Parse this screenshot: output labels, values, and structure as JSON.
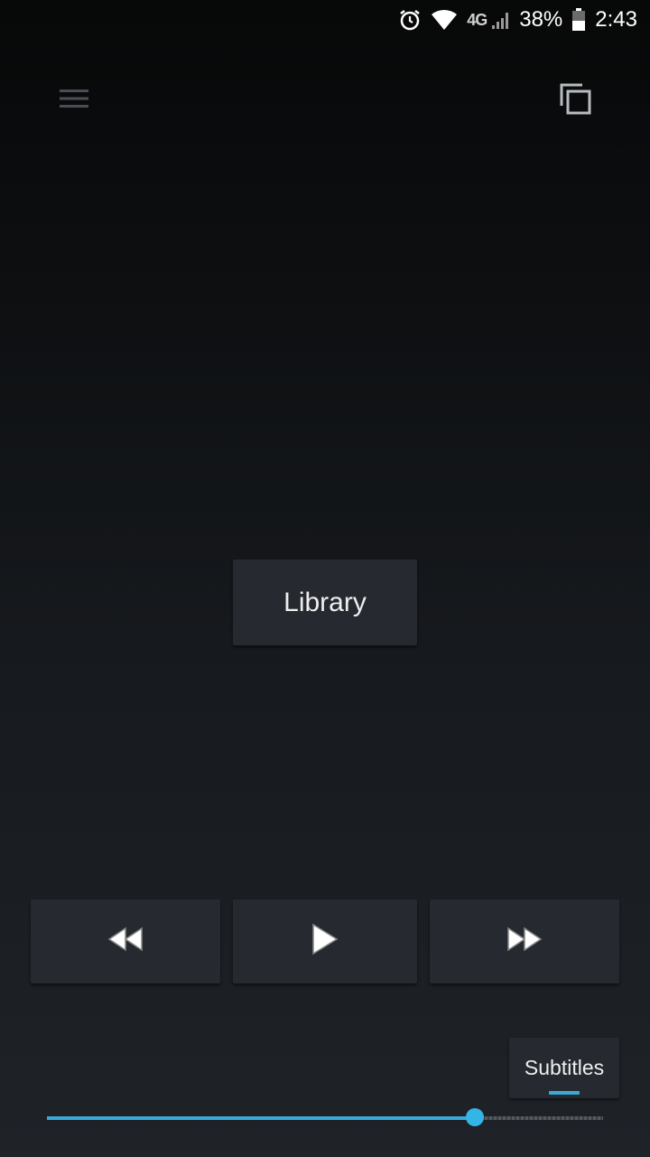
{
  "status_bar": {
    "network_type": "4G",
    "battery_percent": "38%",
    "battery_level": 0.38,
    "time": "2:43"
  },
  "toolbar": {
    "menu_icon": "hamburger-menu-icon",
    "right_icon": "copy-icon"
  },
  "library_button": {
    "label": "Library"
  },
  "playback": {
    "rewind_icon": "rewind-icon",
    "play_icon": "play-icon",
    "fast_forward_icon": "fast-forward-icon"
  },
  "subtitles_button": {
    "label": "Subtitles"
  },
  "seek_bar": {
    "progress": 0.77
  },
  "colors": {
    "accent": "#33b5e5",
    "button_bg": "#262a30"
  }
}
